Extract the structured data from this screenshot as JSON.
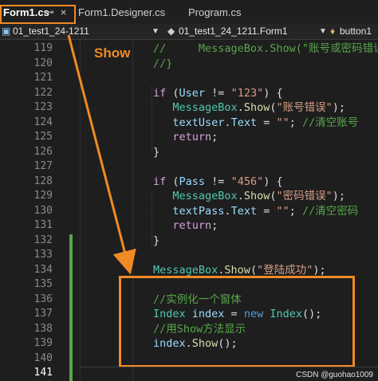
{
  "tabs": {
    "active": {
      "label": "Form1.cs",
      "pin": "⊸",
      "close": "✕"
    },
    "others": [
      "Form1.Designer.cs",
      "Program.cs"
    ]
  },
  "nav": {
    "project": "01_test1_24-1211",
    "type": "01_test1_24_1211.Form1",
    "member": "button1"
  },
  "annotation": {
    "label": "Show",
    "color": "#f08a24"
  },
  "line_numbers": [
    119,
    120,
    121,
    122,
    123,
    124,
    125,
    126,
    127,
    128,
    129,
    130,
    131,
    132,
    133,
    134,
    135,
    136,
    137,
    138,
    139,
    140,
    141
  ],
  "current_line": 141,
  "code": [
    {
      "n": 119,
      "parts": [
        [
          "cm",
          "//     MessageBox.Show(\"账号或密码错误"
        ]
      ]
    },
    {
      "n": 120,
      "parts": [
        [
          "cm",
          "//}"
        ]
      ]
    },
    {
      "n": 121,
      "parts": []
    },
    {
      "n": 122,
      "parts": [
        [
          "ctl",
          "if"
        ],
        [
          "tx",
          " ("
        ],
        [
          "id",
          "User"
        ],
        [
          "tx",
          " != "
        ],
        [
          "str",
          "\"123\""
        ],
        [
          "tx",
          ") {"
        ]
      ]
    },
    {
      "n": 123,
      "parts": [
        [
          "tx",
          "   "
        ],
        [
          "ty",
          "MessageBox"
        ],
        [
          "tx",
          "."
        ],
        [
          "mt",
          "Show"
        ],
        [
          "tx",
          "("
        ],
        [
          "str",
          "\"账号错误\""
        ],
        [
          "tx",
          ");"
        ]
      ]
    },
    {
      "n": 124,
      "parts": [
        [
          "tx",
          "   "
        ],
        [
          "id",
          "textUser"
        ],
        [
          "tx",
          "."
        ],
        [
          "id",
          "Text"
        ],
        [
          "tx",
          " = "
        ],
        [
          "str",
          "\"\""
        ],
        [
          "tx",
          "; "
        ],
        [
          "cm",
          "//清空账号"
        ]
      ]
    },
    {
      "n": 125,
      "parts": [
        [
          "tx",
          "   "
        ],
        [
          "ctl",
          "return"
        ],
        [
          "tx",
          ";"
        ]
      ]
    },
    {
      "n": 126,
      "parts": [
        [
          "tx",
          "}"
        ]
      ]
    },
    {
      "n": 127,
      "parts": []
    },
    {
      "n": 128,
      "parts": [
        [
          "ctl",
          "if"
        ],
        [
          "tx",
          " ("
        ],
        [
          "id",
          "Pass"
        ],
        [
          "tx",
          " != "
        ],
        [
          "str",
          "\"456\""
        ],
        [
          "tx",
          ") {"
        ]
      ]
    },
    {
      "n": 129,
      "parts": [
        [
          "tx",
          "   "
        ],
        [
          "ty",
          "MessageBox"
        ],
        [
          "tx",
          "."
        ],
        [
          "mt",
          "Show"
        ],
        [
          "tx",
          "("
        ],
        [
          "str",
          "\"密码错误\""
        ],
        [
          "tx",
          ");"
        ]
      ]
    },
    {
      "n": 130,
      "parts": [
        [
          "tx",
          "   "
        ],
        [
          "id",
          "textPass"
        ],
        [
          "tx",
          "."
        ],
        [
          "id",
          "Text"
        ],
        [
          "tx",
          " = "
        ],
        [
          "str",
          "\"\""
        ],
        [
          "tx",
          "; "
        ],
        [
          "cm",
          "//清空密码"
        ]
      ]
    },
    {
      "n": 131,
      "parts": [
        [
          "tx",
          "   "
        ],
        [
          "ctl",
          "return"
        ],
        [
          "tx",
          ";"
        ]
      ]
    },
    {
      "n": 132,
      "parts": [
        [
          "tx",
          "}"
        ]
      ]
    },
    {
      "n": 133,
      "parts": []
    },
    {
      "n": 134,
      "parts": [
        [
          "ty",
          "MessageBox"
        ],
        [
          "tx",
          "."
        ],
        [
          "mt",
          "Show"
        ],
        [
          "tx",
          "("
        ],
        [
          "str",
          "\"登陆成功\""
        ],
        [
          "tx",
          ");"
        ]
      ]
    },
    {
      "n": 135,
      "parts": []
    },
    {
      "n": 136,
      "parts": [
        [
          "cm",
          "//实例化一个窗体"
        ]
      ]
    },
    {
      "n": 137,
      "parts": [
        [
          "ty",
          "Index"
        ],
        [
          "tx",
          " "
        ],
        [
          "id",
          "index"
        ],
        [
          "tx",
          " = "
        ],
        [
          "kw",
          "new"
        ],
        [
          "tx",
          " "
        ],
        [
          "ty",
          "Index"
        ],
        [
          "tx",
          "();"
        ]
      ]
    },
    {
      "n": 138,
      "parts": [
        [
          "cm",
          "//用Show方法显示"
        ]
      ]
    },
    {
      "n": 139,
      "parts": [
        [
          "id",
          "index"
        ],
        [
          "tx",
          "."
        ],
        [
          "mt",
          "Show"
        ],
        [
          "tx",
          "();"
        ]
      ]
    },
    {
      "n": 140,
      "parts": []
    },
    {
      "n": 141,
      "parts": []
    }
  ],
  "watermark": "CSDN @guohao1009"
}
